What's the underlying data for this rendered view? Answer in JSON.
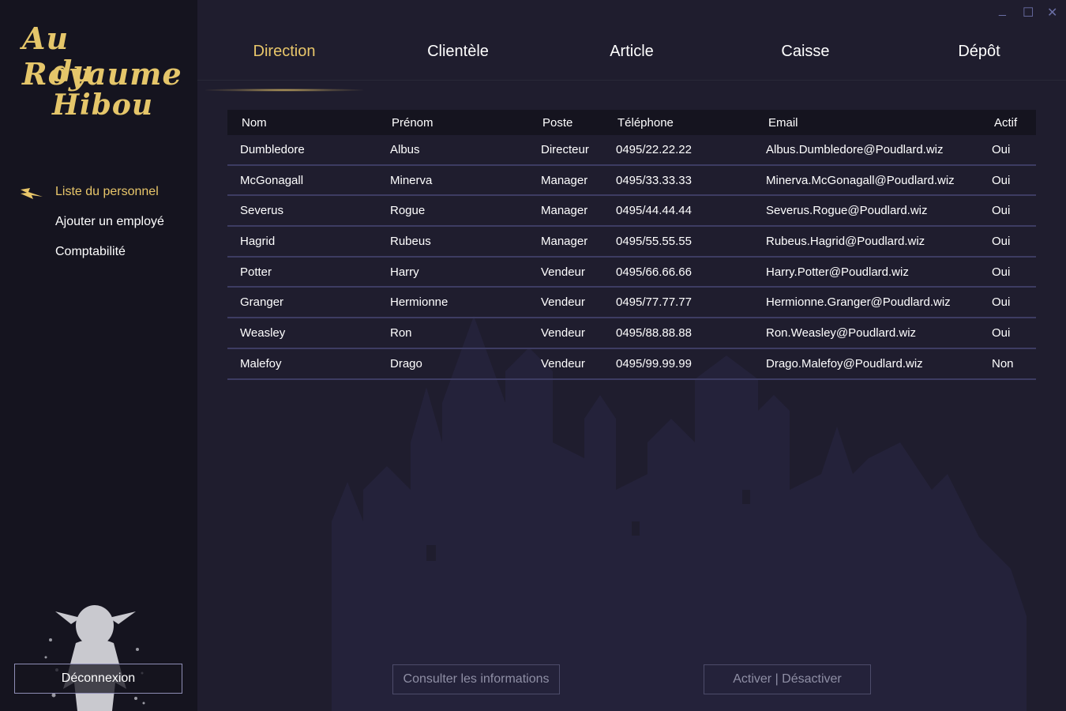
{
  "logo": {
    "line1": "Au Royaume",
    "line2": "du Hibou"
  },
  "sidebar": {
    "items": [
      {
        "label": "Liste du personnel"
      },
      {
        "label": "Ajouter un employé"
      },
      {
        "label": "Comptabilité"
      }
    ],
    "logout_label": "Déconnexion"
  },
  "window": {
    "minimize": "_",
    "maximize": "☐",
    "close": "✕"
  },
  "tabs": [
    {
      "label": "Direction"
    },
    {
      "label": "Clientèle"
    },
    {
      "label": "Article"
    },
    {
      "label": "Caisse"
    },
    {
      "label": "Dépôt"
    }
  ],
  "table": {
    "headers": [
      "Nom",
      "Prénom",
      "Poste",
      "Téléphone",
      "Email",
      "Actif"
    ],
    "rows": [
      [
        "Dumbledore",
        "Albus",
        "Directeur",
        "0495/22.22.22",
        "Albus.Dumbledore@Poudlard.wiz",
        "Oui"
      ],
      [
        "McGonagall",
        "Minerva",
        "Manager",
        "0495/33.33.33",
        "Minerva.McGonagall@Poudlard.wiz",
        "Oui"
      ],
      [
        "Severus",
        "Rogue",
        "Manager",
        "0495/44.44.44",
        "Severus.Rogue@Poudlard.wiz",
        "Oui"
      ],
      [
        "Hagrid",
        "Rubeus",
        "Manager",
        "0495/55.55.55",
        "Rubeus.Hagrid@Poudlard.wiz",
        "Oui"
      ],
      [
        "Potter",
        "Harry",
        "Vendeur",
        "0495/66.66.66",
        "Harry.Potter@Poudlard.wiz",
        "Oui"
      ],
      [
        "Granger",
        "Hermionne",
        "Vendeur",
        "0495/77.77.77",
        "Hermionne.Granger@Poudlard.wiz",
        "Oui"
      ],
      [
        "Weasley",
        "Ron",
        "Vendeur",
        "0495/88.88.88",
        "Ron.Weasley@Poudlard.wiz",
        "Oui"
      ],
      [
        "Malefoy",
        "Drago",
        "Vendeur",
        "0495/99.99.99",
        "Drago.Malefoy@Poudlard.wiz",
        "Non"
      ]
    ]
  },
  "actions": {
    "consult_label": "Consulter les informations",
    "toggle_label": "Activer | Désactiver"
  },
  "colors": {
    "accent": "#e8c66a",
    "background": "#1f1d2e",
    "sidebar": "#15141f",
    "row_divider": "#3d3c62"
  },
  "icons": [
    "lightning-bolt-icon",
    "minimize-icon",
    "maximize-icon",
    "close-icon"
  ]
}
